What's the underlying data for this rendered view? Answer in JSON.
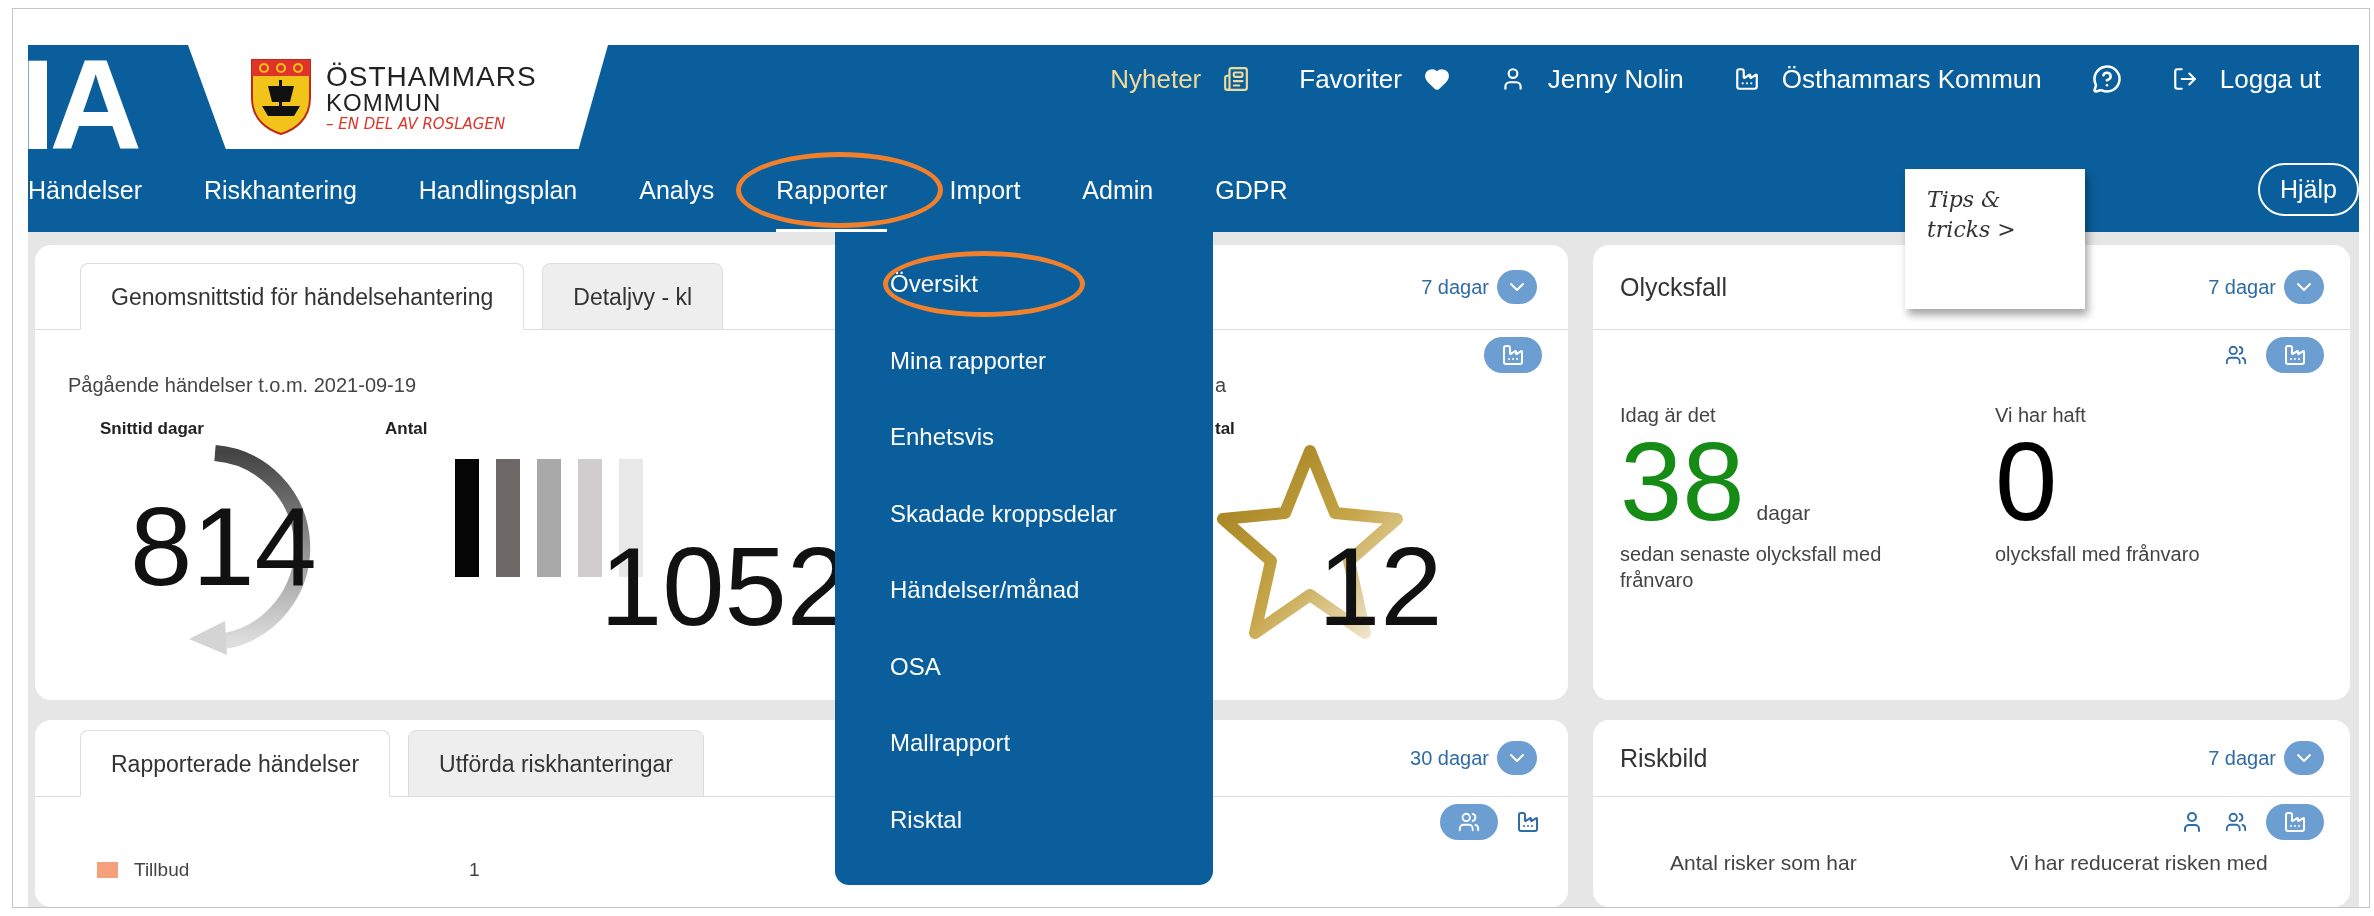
{
  "header": {
    "logo_text": "IA",
    "municipality": {
      "name": "ÖSTHAMMARS",
      "line2": "KOMMUN",
      "tagline": "– EN DEL AV ROSLAGEN"
    },
    "top_links": [
      {
        "kind": "news",
        "label": "Nyheter"
      },
      {
        "kind": "favorites",
        "label": "Favoriter"
      },
      {
        "kind": "user",
        "label": "Jenny Nolin"
      },
      {
        "kind": "org",
        "label": "Östhammars Kommun"
      },
      {
        "kind": "help"
      },
      {
        "kind": "logout",
        "label": "Logga ut"
      }
    ],
    "nav": [
      {
        "label": "Händelser",
        "selected": false,
        "circled": false
      },
      {
        "label": "Riskhantering",
        "selected": false,
        "circled": false
      },
      {
        "label": "Handlingsplan",
        "selected": false,
        "circled": false
      },
      {
        "label": "Analys",
        "selected": false,
        "circled": false
      },
      {
        "label": "Rapporter",
        "selected": true,
        "circled": true
      },
      {
        "label": "Import",
        "selected": false,
        "circled": false
      },
      {
        "label": "Admin",
        "selected": false,
        "circled": false
      },
      {
        "label": "GDPR",
        "selected": false,
        "circled": false
      }
    ],
    "tips_note": "Tips & tricks >",
    "help_button": "Hjälp"
  },
  "dropdown": {
    "items": [
      {
        "label": "Översikt",
        "circled": true
      },
      {
        "label": "Mina rapporter",
        "circled": false
      },
      {
        "label": "Enhetsvis",
        "circled": false
      },
      {
        "label": "Skadade kroppsdelar",
        "circled": false
      },
      {
        "label": "Händelser/månad",
        "circled": false
      },
      {
        "label": "OSA",
        "circled": false
      },
      {
        "label": "Mallrapport",
        "circled": false
      },
      {
        "label": "Risktal",
        "circled": false
      }
    ]
  },
  "handling_time_card": {
    "tabs": [
      {
        "label": "Genomsnittstid för händelsehantering",
        "selected": true
      },
      {
        "label": "Detaljvy - kl",
        "selected": false
      }
    ],
    "period": "7 dagar",
    "toggles": [
      {
        "kind": "unit",
        "selected": true
      }
    ],
    "subtitle": "Pågående händelser t.o.m. 2021-09-19",
    "subtitle_tail": "a",
    "metrics": [
      {
        "kind": "gauge",
        "label": "Snittid dagar",
        "value": "814"
      },
      {
        "kind": "bars",
        "label": "Antal",
        "value": "1052"
      },
      {
        "kind": "star",
        "label": "tal",
        "value": "12"
      }
    ]
  },
  "accidents_card": {
    "title": "Olycksfall",
    "period": "7 dagar",
    "toggles": [
      {
        "kind": "group",
        "selected": false
      },
      {
        "kind": "unit",
        "selected": true
      }
    ],
    "columns": [
      {
        "intro": "Idag är det",
        "value": "38",
        "unit": "dagar",
        "caption": "sedan senaste olycksfall med frånvaro",
        "color": "#168c16"
      },
      {
        "intro": "Vi har haft",
        "value": "0",
        "caption": "olycksfall med frånvaro",
        "color": "#000000"
      }
    ]
  },
  "reported_card": {
    "tabs": [
      {
        "label": "Rapporterade händelser",
        "selected": true
      },
      {
        "label": "Utförda riskhanteringar",
        "selected": false
      }
    ],
    "period": "30 dagar",
    "toggles": [
      {
        "kind": "group",
        "selected": true
      },
      {
        "kind": "unit",
        "selected": false
      }
    ],
    "legend": [
      {
        "label": "Tillbud",
        "value": "1",
        "color": "#f5a07a"
      }
    ]
  },
  "risk_card": {
    "title": "Riskbild",
    "period": "7 dagar",
    "toggles": [
      {
        "kind": "person",
        "selected": false
      },
      {
        "kind": "group",
        "selected": false
      },
      {
        "kind": "unit",
        "selected": true
      }
    ],
    "texts": [
      "Antal risker som har",
      "Vi har reducerat risken med"
    ]
  }
}
